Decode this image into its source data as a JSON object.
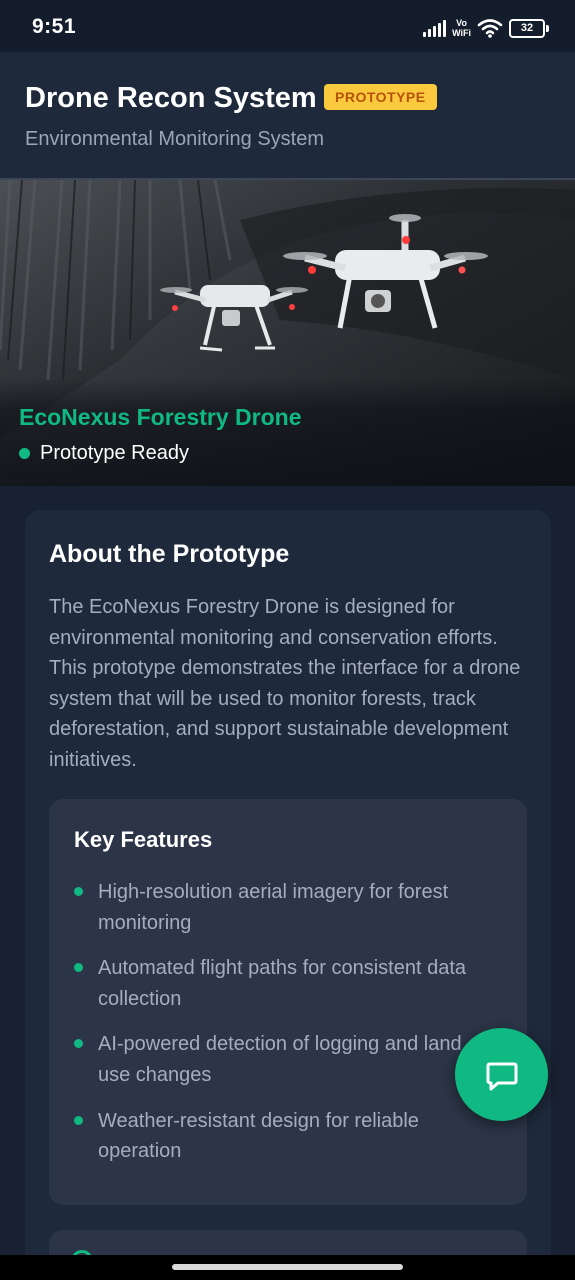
{
  "status_bar": {
    "time": "9:51",
    "network_label_top": "Vo",
    "network_label_bottom": "WiFi",
    "battery": "32"
  },
  "header": {
    "title": "Drone Recon System",
    "badge": "PROTOTYPE",
    "subtitle": "Environmental Monitoring System"
  },
  "hero": {
    "title": "EcoNexus Forestry Drone",
    "status": "Prototype Ready"
  },
  "about": {
    "title": "About the Prototype",
    "body": "The EcoNexus Forestry Drone is designed for environmental monitoring and conservation efforts. This prototype demonstrates the interface for a drone system that will be used to monitor forests, track deforestation, and support sustainable development initiatives."
  },
  "features": {
    "title": "Key Features",
    "items": [
      {
        "text": "High-resolution aerial imagery for forest monitoring"
      },
      {
        "text": "Automated flight paths for consistent data collection"
      },
      {
        "text": "AI-powered detection of logging and land use changes"
      },
      {
        "text": "Weather-resistant design for reliable operation"
      }
    ]
  },
  "colors": {
    "accent": "#10b981",
    "badge_bg": "#fbc93d",
    "badge_text": "#b45309",
    "background": "#182131",
    "card": "#1e293b",
    "inner_card": "#2b3547"
  },
  "icons": {
    "fab": "chat-bubble-icon",
    "next_section": "check-circle-icon"
  }
}
